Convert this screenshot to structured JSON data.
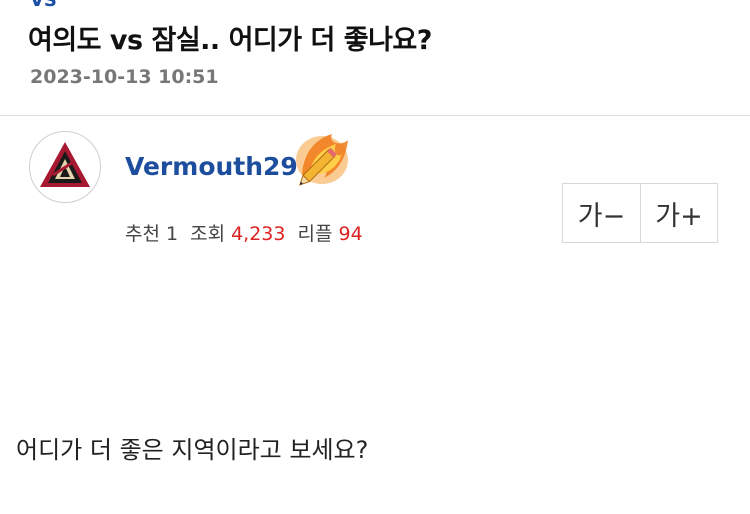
{
  "post": {
    "category": "VS",
    "title": "여의도 vs 잠실.. 어디가 더 좋나요?",
    "date": "2023-10-13 10:51",
    "body": "어디가 더 좋은 지역이라고 보세요?"
  },
  "author": {
    "name": "Vermouth29",
    "avatar_icon": "team-logo-a-icon",
    "badge_icon": "flaming-pencil-icon"
  },
  "stats": {
    "recommend_label": "추천",
    "recommend_value": "1",
    "views_label": "조회",
    "views_value": "4,233",
    "replies_label": "리플",
    "replies_value": "94"
  },
  "font_controls": {
    "decrease_label": "가−",
    "increase_label": "가+"
  },
  "colors": {
    "username": "#1d4e9e",
    "stat_number": "#dd2222",
    "date": "#777777"
  }
}
